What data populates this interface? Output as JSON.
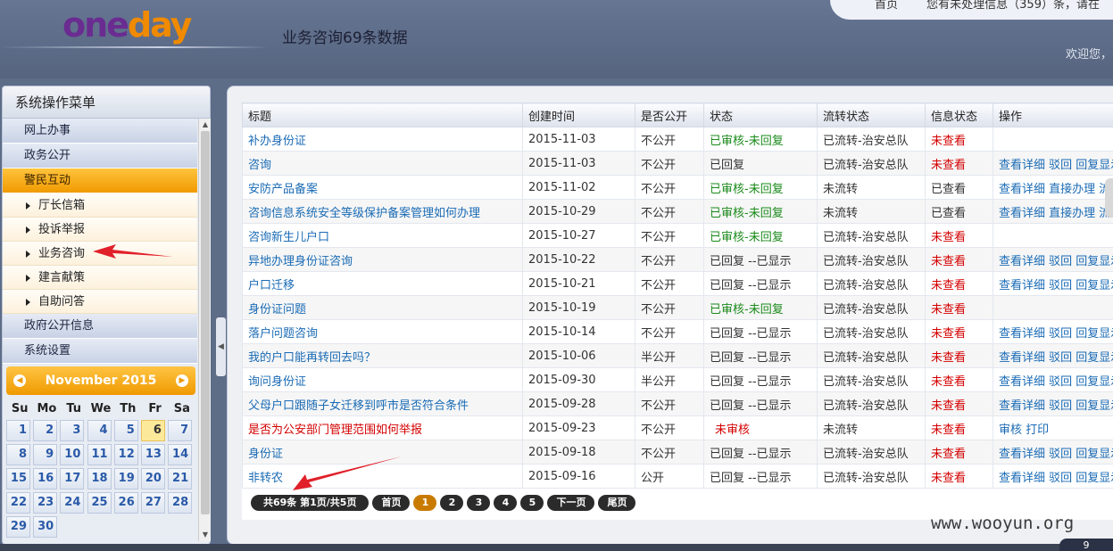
{
  "header": {
    "logo_one": "one",
    "logo_day": "day",
    "title": "业务咨询69条数据",
    "home_link": "首页",
    "notice": "您有未处理信息（359）条，请在",
    "welcome": "欢迎您，"
  },
  "sidebar": {
    "title": "系统操作菜单",
    "groups": [
      "网上办事",
      "政务公开",
      "警民互动",
      "政府公开信息",
      "系统设置"
    ],
    "subitems": [
      "厅长信箱",
      "投诉举报",
      "业务咨询",
      "建言献策",
      "自助问答"
    ]
  },
  "calendar": {
    "month": "November 2015",
    "weekdays": [
      "Su",
      "Mo",
      "Tu",
      "We",
      "Th",
      "Fr",
      "Sa"
    ],
    "days": [
      "1",
      "2",
      "3",
      "4",
      "5",
      "6",
      "7",
      "8",
      "9",
      "10",
      "11",
      "12",
      "13",
      "14",
      "15",
      "16",
      "17",
      "18",
      "19",
      "20",
      "21",
      "22",
      "23",
      "24",
      "25",
      "26",
      "27",
      "28",
      "29",
      "30"
    ],
    "today": "6"
  },
  "table": {
    "headers": [
      "标题",
      "创建时间",
      "是否公开",
      "状态",
      "流转状态",
      "信息状态",
      "操作"
    ],
    "rows": [
      {
        "title": "补办身份证",
        "date": "2015-11-03",
        "public": "不公开",
        "status": "已审核-未回复",
        "flow": "已流转-治安总队",
        "info": "未查看",
        "ops": ""
      },
      {
        "title": "咨询",
        "date": "2015-11-03",
        "public": "不公开",
        "status": "已回复",
        "flow": "已流转-治安总队",
        "info": "未查看",
        "ops": "查看详细 驳回 回复显示"
      },
      {
        "title": "安防产品备案",
        "date": "2015-11-02",
        "public": "不公开",
        "status": "已审核-未回复",
        "flow": "未流转",
        "info": "已查看",
        "ops": "查看详细 直接办理 流转"
      },
      {
        "title": "咨询信息系统安全等级保护备案管理如何办理",
        "date": "2015-10-29",
        "public": "不公开",
        "status": "已审核-未回复",
        "flow": "未流转",
        "info": "已查看",
        "ops": "查看详细 直接办理 流转"
      },
      {
        "title": "咨询新生儿户口",
        "date": "2015-10-27",
        "public": "不公开",
        "status": "已审核-未回复",
        "flow": "已流转-治安总队",
        "info": "未查看",
        "ops": ""
      },
      {
        "title": "异地办理身份证咨询",
        "date": "2015-10-22",
        "public": "不公开",
        "status": "已回复 --已显示",
        "flow": "已流转-治安总队",
        "info": "未查看",
        "ops": "查看详细 驳回 回复显示"
      },
      {
        "title": "户口迁移",
        "date": "2015-10-21",
        "public": "不公开",
        "status": "已回复 --已显示",
        "flow": "已流转-治安总队",
        "info": "未查看",
        "ops": "查看详细 驳回 回复显示"
      },
      {
        "title": "身份证问题",
        "date": "2015-10-19",
        "public": "不公开",
        "status": "已审核-未回复",
        "flow": "已流转-治安总队",
        "info": "未查看",
        "ops": ""
      },
      {
        "title": "落户问题咨询",
        "date": "2015-10-14",
        "public": "不公开",
        "status": "已回复 --已显示",
        "flow": "已流转-治安总队",
        "info": "未查看",
        "ops": "查看详细 驳回 回复显示"
      },
      {
        "title": "我的户口能再转回去吗？",
        "date": "2015-10-06",
        "public": "半公开",
        "status": "已回复 --已显示",
        "flow": "已流转-治安总队",
        "info": "未查看",
        "ops": "查看详细 驳回 回复显示"
      },
      {
        "title": "询问身份证",
        "date": "2015-09-30",
        "public": "半公开",
        "status": "已回复 --已显示",
        "flow": "已流转-治安总队",
        "info": "未查看",
        "ops": "查看详细 驳回 回复显示"
      },
      {
        "title": "父母户口跟随子女迁移到呼市是否符合条件",
        "date": "2015-09-28",
        "public": "不公开",
        "status": "已回复 --已显示",
        "flow": "已流转-治安总队",
        "info": "未查看",
        "ops": "查看详细 驳回 回复显示"
      },
      {
        "title": "是否为公安部门管理范围如何举报",
        "date": "2015-09-23",
        "public": "不公开",
        "status": "未审核",
        "flow": "未流转",
        "info": "未查看",
        "ops": "审核 打印"
      },
      {
        "title": "身份证",
        "date": "2015-09-18",
        "public": "不公开",
        "status": "已回复 --已显示",
        "flow": "已流转-治安总队",
        "info": "未查看",
        "ops": "查看详细 驳回 回复显示"
      },
      {
        "title": "非转农",
        "date": "2015-09-16",
        "public": "公开",
        "status": "已回复 --已显示",
        "flow": "已流转-治安总队",
        "info": "未查看",
        "ops": "查看详细 驳回 回复显示"
      }
    ]
  },
  "pager": {
    "info": "共69条 第1页/共5页",
    "first": "首页",
    "pages": [
      "1",
      "2",
      "3",
      "4",
      "5"
    ],
    "next": "下一页",
    "last": "尾页"
  },
  "watermark": "www.wooyun.org",
  "corner_badge": "9",
  "colors": {
    "header_bg": "#667693",
    "accent_orange": "#f09a00",
    "link_blue": "#1a6bb5",
    "status_red": "#d40000",
    "status_green": "#1a8a1a",
    "annotation_red": "#e0212a"
  }
}
